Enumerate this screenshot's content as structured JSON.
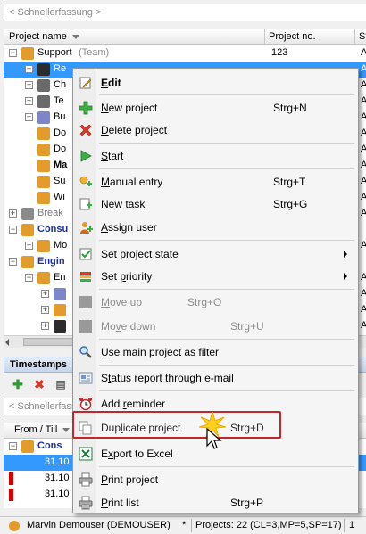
{
  "project_panel": {
    "quick_entry_placeholder": "< Schnellerfassung >",
    "columns": {
      "project_name": "Project name",
      "project_no": "Project no.",
      "status_short": "St"
    },
    "rows": [
      {
        "name": "Support",
        "sub": "(Team)",
        "no": "123",
        "st": "A",
        "indent": 0,
        "toggle": "−"
      },
      {
        "name": "Re",
        "sub": "",
        "no": "",
        "st": "A",
        "indent": 1,
        "toggle": "+"
      },
      {
        "name": "Ch",
        "sub": "",
        "no": "",
        "st": "A",
        "indent": 1,
        "toggle": "+"
      },
      {
        "name": "Te",
        "sub": "",
        "no": "",
        "st": "A",
        "indent": 1,
        "toggle": "+"
      },
      {
        "name": "Bu",
        "sub": "",
        "no": "",
        "st": "A",
        "indent": 1,
        "toggle": "+"
      },
      {
        "name": "Do",
        "sub": "",
        "no": "",
        "st": "A",
        "indent": 1,
        "toggle": ""
      },
      {
        "name": "Do",
        "sub": "",
        "no": "",
        "st": "A",
        "indent": 1,
        "toggle": ""
      },
      {
        "name": "Ma",
        "sub": "",
        "no": "",
        "st": "A",
        "indent": 1,
        "toggle": ""
      },
      {
        "name": "Su",
        "sub": "",
        "no": "",
        "st": "A",
        "indent": 1,
        "toggle": ""
      },
      {
        "name": "Wi",
        "sub": "",
        "no": "",
        "st": "A",
        "indent": 1,
        "toggle": ""
      },
      {
        "name": "Break",
        "sub": "",
        "no": "",
        "st": "A",
        "indent": 0,
        "toggle": "+"
      },
      {
        "name": "Consu",
        "sub": "",
        "no": "",
        "st": "",
        "indent": 0,
        "toggle": "−"
      },
      {
        "name": "Mo",
        "sub": "",
        "no": "",
        "st": "A",
        "indent": 1,
        "toggle": "+"
      },
      {
        "name": "Engin",
        "sub": "",
        "no": "",
        "st": "",
        "indent": 0,
        "toggle": "−"
      },
      {
        "name": "En",
        "sub": "",
        "no": "",
        "st": "A",
        "indent": 1,
        "toggle": "−"
      },
      {
        "name": "",
        "sub": "",
        "no": "",
        "st": "A",
        "indent": 2,
        "toggle": "+"
      },
      {
        "name": "",
        "sub": "",
        "no": "",
        "st": "A",
        "indent": 2,
        "toggle": "+"
      },
      {
        "name": "",
        "sub": "",
        "no": "",
        "st": "A",
        "indent": 2,
        "toggle": "+"
      }
    ]
  },
  "timestamps_panel": {
    "title": "Timestamps",
    "quick_entry_placeholder": "< Schnellerfassung",
    "col_from_till": "From / Till",
    "rows": [
      {
        "text": "Cons"
      },
      {
        "text": "31.10"
      },
      {
        "text": "31.10"
      },
      {
        "text": "31.10"
      }
    ]
  },
  "status_bar": {
    "user": "Marvin Demouser (DEMOUSER)",
    "modified_mark": "*",
    "projects": "Projects: 22 (CL=3,MP=5,SP=17)",
    "extra": "1"
  },
  "context_menu": {
    "items": [
      {
        "label": "Edit",
        "shortcut": "",
        "icon": "edit-icon",
        "bold": true,
        "disabled": false,
        "submenu": false
      },
      {
        "label": "New project",
        "shortcut": "Strg+N",
        "icon": "plus-icon",
        "bold": false,
        "disabled": false,
        "submenu": false
      },
      {
        "label": "Delete project",
        "shortcut": "",
        "icon": "delete-x-icon",
        "bold": false,
        "disabled": false,
        "submenu": false
      },
      {
        "label": "Start",
        "shortcut": "",
        "icon": "play-icon",
        "bold": false,
        "disabled": false,
        "submenu": false
      },
      {
        "label": "Manual entry",
        "shortcut": "Strg+T",
        "icon": "manual-entry-icon",
        "bold": false,
        "disabled": false,
        "submenu": false
      },
      {
        "label": "New task",
        "shortcut": "Strg+G",
        "icon": "new-task-icon",
        "bold": false,
        "disabled": false,
        "submenu": false
      },
      {
        "label": "Assign user",
        "shortcut": "",
        "icon": "assign-user-icon",
        "bold": false,
        "disabled": false,
        "submenu": false
      },
      {
        "label": "Set project state",
        "shortcut": "",
        "icon": "project-state-icon",
        "bold": false,
        "disabled": false,
        "submenu": true
      },
      {
        "label": "Set priority",
        "shortcut": "",
        "icon": "priority-icon",
        "bold": false,
        "disabled": false,
        "submenu": true
      },
      {
        "label": "Move up",
        "shortcut": "Strg+O",
        "icon": "move-up-icon",
        "bold": false,
        "disabled": true,
        "submenu": false
      },
      {
        "label": "Move down",
        "shortcut": "Strg+U",
        "icon": "move-down-icon",
        "bold": false,
        "disabled": true,
        "submenu": false
      },
      {
        "label": "Use main project as filter",
        "shortcut": "",
        "icon": "filter-magnifier-icon",
        "bold": false,
        "disabled": false,
        "submenu": false
      },
      {
        "label": "Status report through e-mail",
        "shortcut": "",
        "icon": "email-report-icon",
        "bold": false,
        "disabled": false,
        "submenu": false
      },
      {
        "label": "Add reminder",
        "shortcut": "",
        "icon": "alarm-clock-icon",
        "bold": false,
        "disabled": false,
        "submenu": false
      },
      {
        "label": "Duplicate project",
        "shortcut": "Strg+D",
        "icon": "duplicate-icon",
        "bold": false,
        "disabled": false,
        "submenu": false
      },
      {
        "label": "Export to Excel",
        "shortcut": "",
        "icon": "excel-icon",
        "bold": false,
        "disabled": false,
        "submenu": false
      },
      {
        "label": "Print project",
        "shortcut": "",
        "icon": "printer-icon",
        "bold": false,
        "disabled": false,
        "submenu": false
      },
      {
        "label": "Print list",
        "shortcut": "Strg+P",
        "icon": "print-list-icon",
        "bold": false,
        "disabled": false,
        "submenu": false
      }
    ]
  },
  "colors": {
    "selection": "#3399ff",
    "highlight_border": "#c0282d",
    "menu_bg": "#f5f5f5",
    "disabled_text": "#8d8d8d"
  }
}
